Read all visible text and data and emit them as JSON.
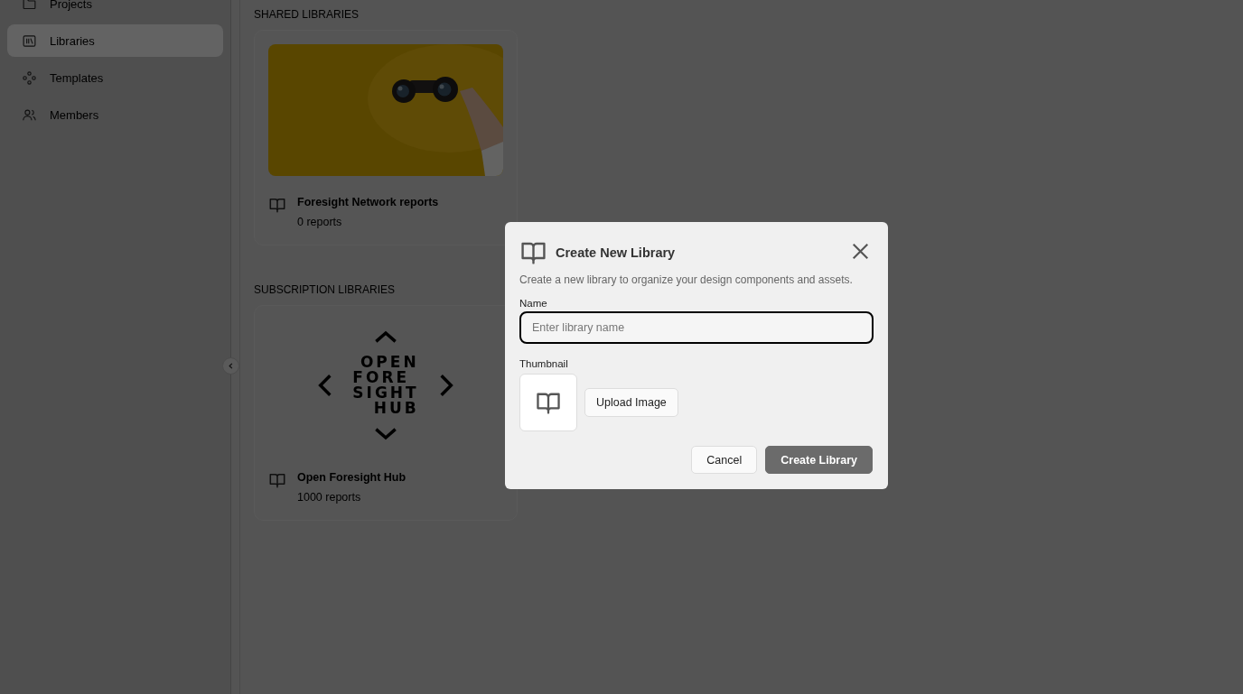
{
  "sidebar": {
    "items": [
      {
        "label": "Projects",
        "selected": false
      },
      {
        "label": "Libraries",
        "selected": true
      },
      {
        "label": "Templates",
        "selected": false
      },
      {
        "label": "Members",
        "selected": false
      }
    ]
  },
  "sections": [
    {
      "heading": "SHARED LIBRARIES",
      "libraries": [
        {
          "title": "Foresight Network reports",
          "count": "0 reports"
        }
      ]
    },
    {
      "heading": "SUBSCRIPTION LIBRARIES",
      "libraries": [
        {
          "title": "Open Foresight Hub",
          "count": "1000 reports",
          "thumbnail": {
            "kind": "logo",
            "lines": [
              "OPEN",
              "FORE",
              "SIGHT",
              "HUB"
            ]
          }
        }
      ]
    }
  ],
  "dialog": {
    "title": "Create New Library",
    "description": "Create a new library to organize your design components and assets.",
    "name_field": {
      "label": "Name",
      "placeholder": "Enter library name"
    },
    "thumbnail": {
      "label": "Thumbnail",
      "button": "Upload Image"
    },
    "buttons": [
      {
        "label": "Cancel",
        "kind": "secondary"
      },
      {
        "label": "Create Library",
        "kind": "primary"
      }
    ]
  }
}
